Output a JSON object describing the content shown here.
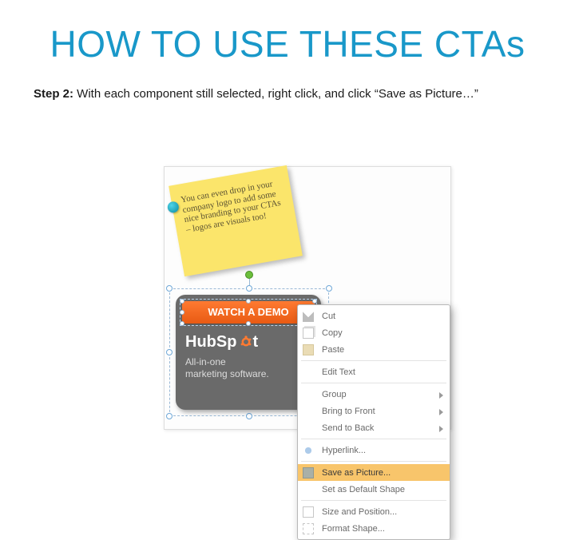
{
  "title": "HOW TO USE THESE CTAs",
  "step": {
    "label": "Step 2:",
    "text": " With each component still selected, right click, and click “Save as Picture…”"
  },
  "sticky_note": "You can even drop in your company logo to add some nice branding to your CTAs – logos are visuals too!",
  "cta": {
    "demo_button": "WATCH A DEMO",
    "brand": "HubSp",
    "brand_suffix": "t",
    "subtitle_line1": "All-in-one",
    "subtitle_line2": "marketing software."
  },
  "context_menu": [
    {
      "label": "Cut",
      "icon": "cut"
    },
    {
      "label": "Copy",
      "icon": "copy"
    },
    {
      "label": "Paste",
      "icon": "paste"
    },
    {
      "sep": true
    },
    {
      "label": "Edit Text"
    },
    {
      "sep": true
    },
    {
      "label": "Group",
      "sub": true
    },
    {
      "label": "Bring to Front",
      "sub": true
    },
    {
      "label": "Send to Back",
      "sub": true
    },
    {
      "sep": true
    },
    {
      "label": "Hyperlink...",
      "icon": "link"
    },
    {
      "sep": true
    },
    {
      "label": "Save as Picture...",
      "icon": "save",
      "highlight": true
    },
    {
      "label": "Set as Default Shape"
    },
    {
      "sep": true
    },
    {
      "label": "Size and Position...",
      "icon": "pos"
    },
    {
      "label": "Format Shape...",
      "icon": "fmt"
    }
  ]
}
